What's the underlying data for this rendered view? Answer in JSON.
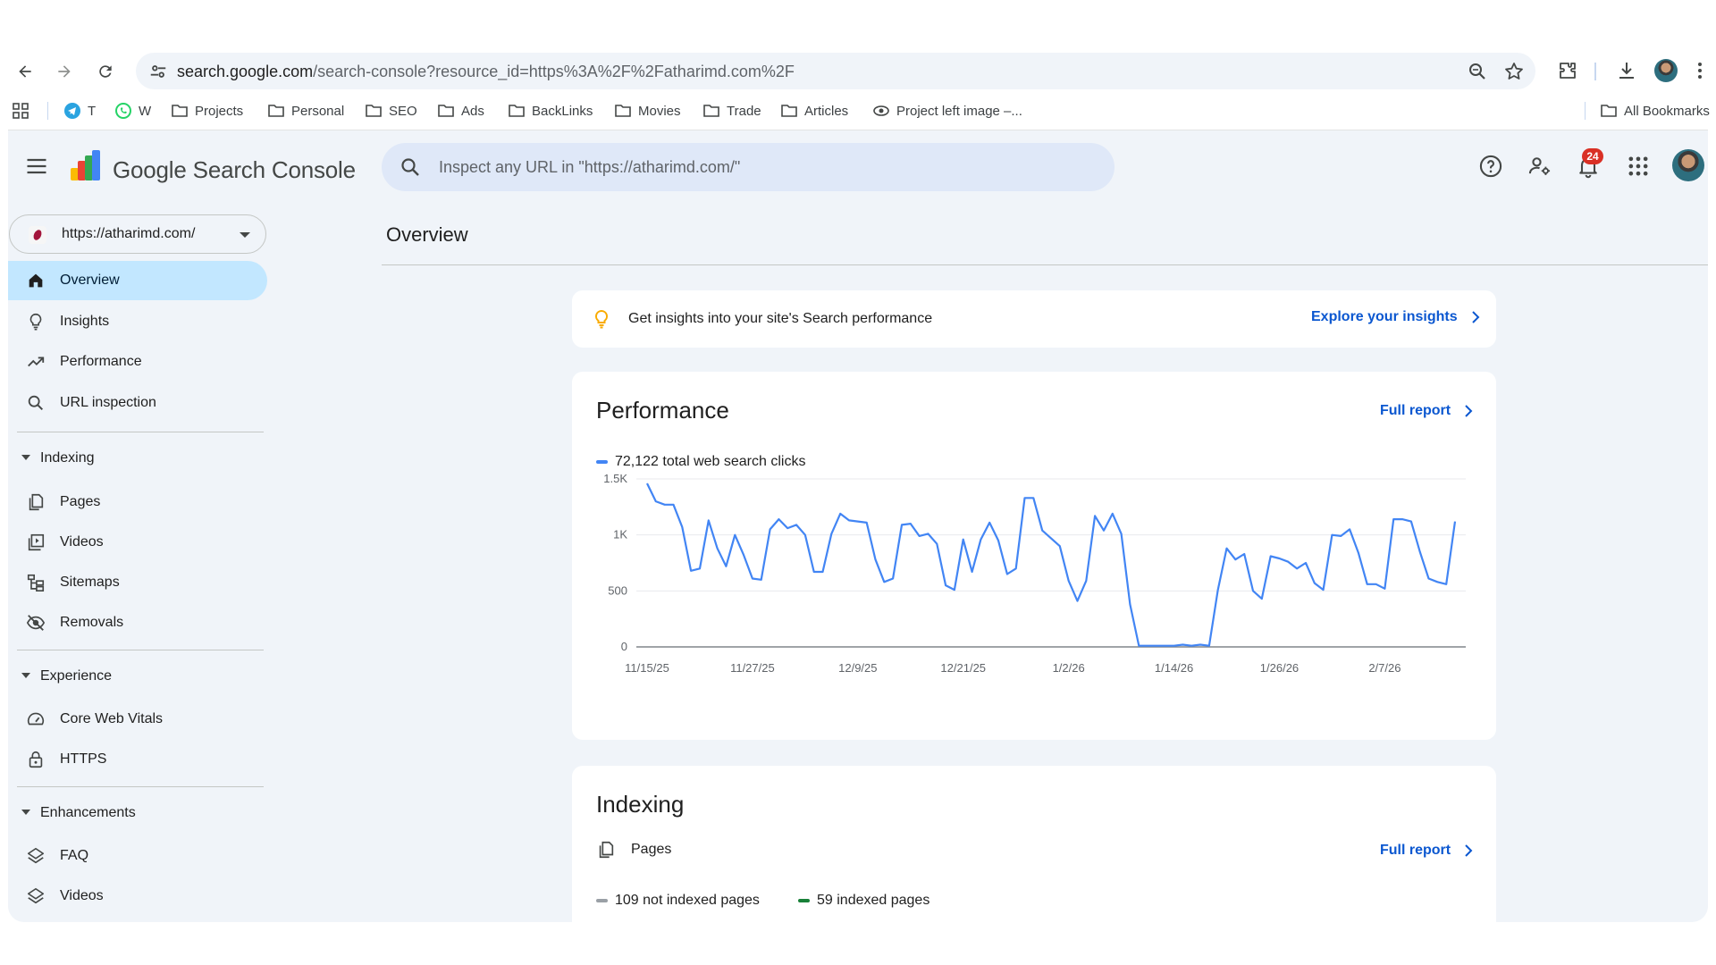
{
  "browser": {
    "url_host": "search.google.com",
    "url_path": "/search-console?resource_id=https%3A%2F%2Fatharimd.com%2F"
  },
  "bookmarks": [
    {
      "label": "T",
      "icon": "telegram-icon"
    },
    {
      "label": "W",
      "icon": "whatsapp-icon"
    },
    {
      "label": "Projects",
      "icon": "folder-icon"
    },
    {
      "label": "Personal",
      "icon": "folder-icon"
    },
    {
      "label": "SEO",
      "icon": "folder-icon"
    },
    {
      "label": "Ads",
      "icon": "folder-icon"
    },
    {
      "label": "BackLinks",
      "icon": "folder-icon"
    },
    {
      "label": "Movies",
      "icon": "folder-icon"
    },
    {
      "label": "Trade",
      "icon": "folder-icon"
    },
    {
      "label": "Articles",
      "icon": "folder-icon"
    },
    {
      "label": "Project left image –...",
      "icon": "eye-icon"
    }
  ],
  "all_bookmarks_label": "All Bookmarks",
  "header": {
    "product_google": "Google",
    "product_name": "Search Console",
    "search_placeholder": "Inspect any URL in \"https://atharimd.com/\"",
    "notification_count": "24"
  },
  "property": "https://atharimd.com/",
  "sidebar": {
    "items": [
      {
        "label": "Overview",
        "icon": "home-icon",
        "active": true
      },
      {
        "label": "Insights",
        "icon": "lightbulb-icon"
      },
      {
        "label": "Performance",
        "icon": "trending-up-icon"
      },
      {
        "label": "URL inspection",
        "icon": "search-icon"
      }
    ],
    "indexing": {
      "label": "Indexing",
      "items": [
        {
          "label": "Pages",
          "icon": "pages-icon"
        },
        {
          "label": "Videos",
          "icon": "video-icon"
        },
        {
          "label": "Sitemaps",
          "icon": "sitemap-icon"
        },
        {
          "label": "Removals",
          "icon": "eye-off-icon"
        }
      ]
    },
    "experience": {
      "label": "Experience",
      "items": [
        {
          "label": "Core Web Vitals",
          "icon": "speedometer-icon"
        },
        {
          "label": "HTTPS",
          "icon": "lock-icon"
        }
      ]
    },
    "enhancements": {
      "label": "Enhancements",
      "items": [
        {
          "label": "FAQ",
          "icon": "layers-icon"
        },
        {
          "label": "Videos",
          "icon": "layers-icon"
        }
      ]
    }
  },
  "main": {
    "page_title": "Overview",
    "insights": {
      "message": "Get insights into your site's Search performance",
      "link": "Explore your insights"
    },
    "performance": {
      "title": "Performance",
      "link": "Full report",
      "legend": "72,122 total web search clicks"
    },
    "indexing": {
      "title": "Indexing",
      "pages_label": "Pages",
      "link": "Full report",
      "not_indexed": "109 not indexed pages",
      "indexed": "59 indexed pages"
    }
  },
  "colors": {
    "accent": "#0b57d0",
    "series": "#4285f4",
    "not_indexed": "#9aa0a6",
    "indexed": "#188038",
    "active_nav": "#c2e7ff",
    "badge": "#d93025"
  },
  "chart_data": {
    "type": "line",
    "x_tick_labels": [
      "11/15/25",
      "11/27/25",
      "12/9/25",
      "12/21/25",
      "1/2/26",
      "1/14/26",
      "1/26/26",
      "2/7/26"
    ],
    "y_tick_labels": [
      "0",
      "500",
      "1K",
      "1.5K"
    ],
    "ylim": [
      0,
      1500
    ],
    "grid": true,
    "series": [
      {
        "name": "72,122 total web search clicks",
        "x_start": "2025-11-15",
        "values": [
          1460,
          1300,
          1270,
          1270,
          1070,
          680,
          700,
          1130,
          880,
          720,
          1000,
          820,
          610,
          600,
          1050,
          1140,
          1060,
          1090,
          1000,
          670,
          670,
          1010,
          1190,
          1130,
          1120,
          1110,
          780,
          580,
          610,
          1090,
          1100,
          990,
          1010,
          920,
          550,
          510,
          960,
          670,
          960,
          1110,
          950,
          650,
          700,
          1330,
          1330,
          1040,
          970,
          900,
          590,
          410,
          590,
          1170,
          1040,
          1190,
          1010,
          380,
          10,
          10,
          10,
          10,
          10,
          20,
          10,
          20,
          10,
          510,
          880,
          780,
          830,
          500,
          430,
          810,
          790,
          760,
          700,
          750,
          570,
          510,
          1000,
          990,
          1050,
          840,
          560,
          560,
          520,
          1140,
          1140,
          1120,
          850,
          610,
          580,
          560,
          1120
        ]
      }
    ]
  }
}
